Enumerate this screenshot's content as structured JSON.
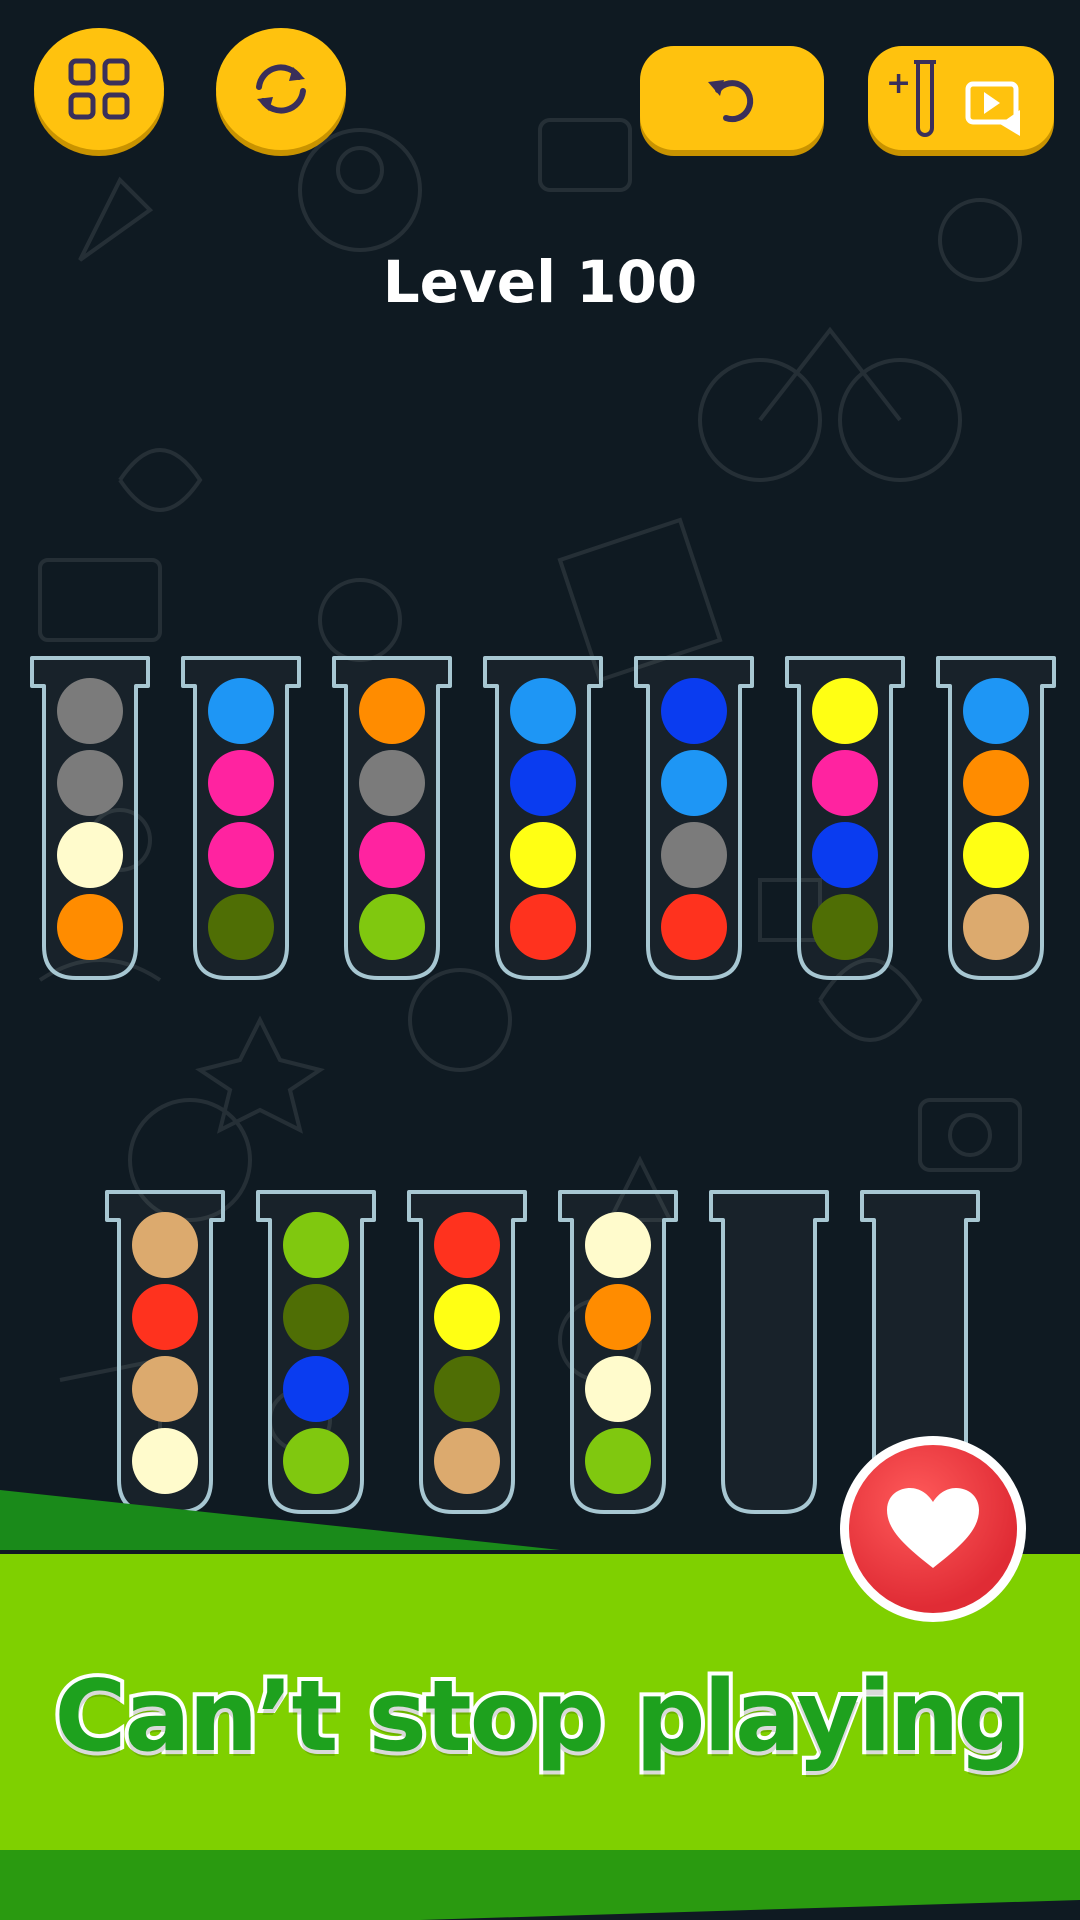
{
  "toolbar": {
    "menu_icon": "grid-icon",
    "restart_icon": "restart-icon",
    "undo_icon": "undo-icon",
    "add_tube_icon": "add-tube-video-icon",
    "add_tube_plus": "+"
  },
  "level": {
    "title": "Level 100"
  },
  "colors": {
    "gray": "#7b7b7b",
    "cream": "#fffbcc",
    "orange": "#ff8c00",
    "skyblue": "#1e96f5",
    "magenta": "#ff23a0",
    "olive": "#4f6e05",
    "lime": "#80c80f",
    "blue": "#0a3cf0",
    "yellow": "#ffff14",
    "red": "#ff321e",
    "tan": "#dcaa6e",
    "accent": "#ffc20e",
    "banner_green": "#7fd000"
  },
  "tubes_row1": [
    {
      "balls": [
        "gray",
        "gray",
        "cream",
        "orange"
      ]
    },
    {
      "balls": [
        "skyblue",
        "magenta",
        "magenta",
        "olive"
      ]
    },
    {
      "balls": [
        "orange",
        "gray",
        "magenta",
        "lime"
      ]
    },
    {
      "balls": [
        "skyblue",
        "blue",
        "yellow",
        "red"
      ]
    },
    {
      "balls": [
        "blue",
        "skyblue",
        "gray",
        "red"
      ]
    },
    {
      "balls": [
        "yellow",
        "magenta",
        "blue",
        "olive"
      ]
    },
    {
      "balls": [
        "skyblue",
        "orange",
        "yellow",
        "tan"
      ]
    }
  ],
  "tubes_row2": [
    {
      "balls": [
        "tan",
        "red",
        "tan",
        "cream"
      ]
    },
    {
      "balls": [
        "lime",
        "olive",
        "blue",
        "lime"
      ]
    },
    {
      "balls": [
        "red",
        "yellow",
        "olive",
        "tan"
      ]
    },
    {
      "balls": [
        "cream",
        "orange",
        "cream",
        "lime"
      ]
    },
    {
      "balls": []
    },
    {
      "balls": []
    }
  ],
  "banner": {
    "text": "Can’t stop playing"
  },
  "like_button": {
    "icon": "heart-icon"
  }
}
